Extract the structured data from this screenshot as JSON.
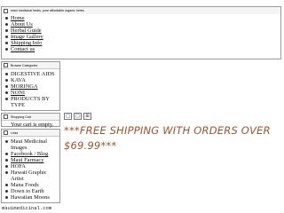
{
  "nav": {
    "title": "maui medicinal herbs, pure affordable organic herbs",
    "items": [
      "Home",
      "About Us",
      "Herbal Guide",
      "Image Gallery",
      "Shipping Info",
      "Contact us"
    ]
  },
  "categories": {
    "title": "Browse Categories",
    "items": [
      "DIGESTIVE AIDS",
      "KAVA",
      "MORINGA",
      "NONI",
      "PRODUCTS BY TYPE"
    ]
  },
  "cart": {
    "title": "Shopping Cart",
    "empty_text": "Your cart is empty."
  },
  "links": {
    "title": "Links",
    "items": [
      "Maui Medicinal Images",
      "Facebook / Blog",
      "Maui Farmacy",
      "HOFA",
      "Hawaii Graphic Artist",
      "Mana Foods",
      "Down to Earth",
      "Hawaiian Moons"
    ]
  },
  "toolbar": {
    "buttons": [
      "□",
      "□",
      "⊞"
    ]
  },
  "promo": {
    "text": "***FREE SHIPPING WITH ORDERS OVER $69.99***"
  },
  "footer": {
    "text": "mauimedicinal.com"
  }
}
